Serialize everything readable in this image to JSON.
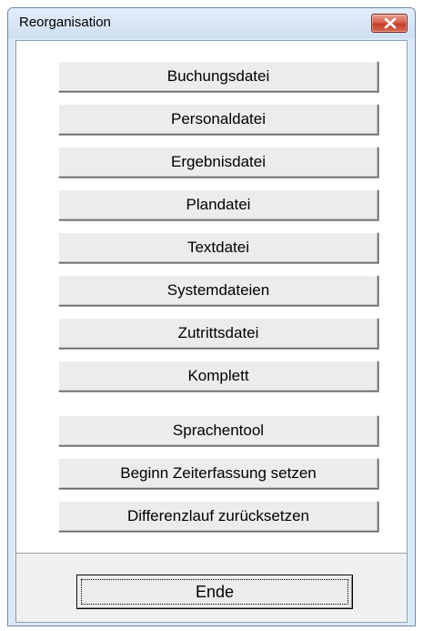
{
  "window": {
    "title": "Reorganisation"
  },
  "buttons": [
    {
      "label": "Buchungsdatei"
    },
    {
      "label": "Personaldatei"
    },
    {
      "label": "Ergebnisdatei"
    },
    {
      "label": "Plandatei"
    },
    {
      "label": "Textdatei"
    },
    {
      "label": "Systemdateien"
    },
    {
      "label": "Zutrittsdatei"
    },
    {
      "label": "Komplett"
    },
    {
      "label": "Sprachentool"
    },
    {
      "label": "Beginn Zeiterfassung setzen"
    },
    {
      "label": "Differenzlauf zurücksetzen"
    }
  ],
  "footer": {
    "ende_label": "Ende"
  },
  "icons": {
    "close": "close-icon"
  },
  "colors": {
    "close_button": "#d9624b",
    "titlebar": "#dbe8f6",
    "dialog_bg": "#f0f0f0"
  }
}
